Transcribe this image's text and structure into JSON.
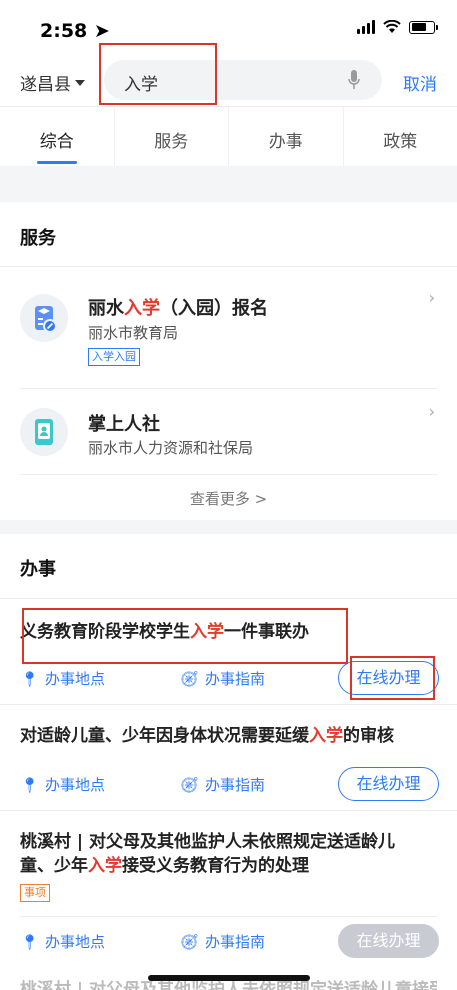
{
  "status": {
    "time": "2:58"
  },
  "search": {
    "location": "遂昌县",
    "query": "入学",
    "cancel": "取消"
  },
  "tabs": [
    "综合",
    "服务",
    "办事",
    "政策"
  ],
  "services": {
    "title": "服务",
    "items": [
      {
        "title_a": "丽水",
        "title_hl": "入学",
        "title_b": "（入园）报名",
        "dept": "丽水市教育局",
        "tag": "入学入园",
        "icon": "education-icon"
      },
      {
        "title_a": "掌上人社",
        "title_hl": "",
        "title_b": "",
        "dept": "丽水市人力资源和社保局",
        "tag": "",
        "icon": "social-security-icon"
      }
    ],
    "more": "查看更多 >"
  },
  "affairs": {
    "title": "办事",
    "items": [
      {
        "title_a": "义务教育阶段学校学生",
        "title_hl": "入学",
        "title_b": "一件事联办",
        "btn": "在线办理",
        "enabled": true
      },
      {
        "title_a": "对适龄儿童、少年因身体状况需要延缓",
        "title_hl": "入学",
        "title_b": "的审核",
        "btn": "在线办理",
        "enabled": true
      },
      {
        "title_a1": "桃溪村 | 对父母及其他监护人未依照规定送适龄儿",
        "title_a2": "童、少年",
        "title_hl": "入学",
        "title_b": "接受义务教育行为的处理",
        "tag": "事项",
        "btn": "在线办理",
        "enabled": false
      }
    ],
    "location_label": "办事地点",
    "guide_label": "办事指南",
    "bottom_peek": "桃溪村 | 对父母及其他监护人未依照规定送适龄儿童接受"
  },
  "colors": {
    "accent": "#2f7bf5",
    "highlight": "#e23b2f",
    "annotation": "#d9362b"
  }
}
